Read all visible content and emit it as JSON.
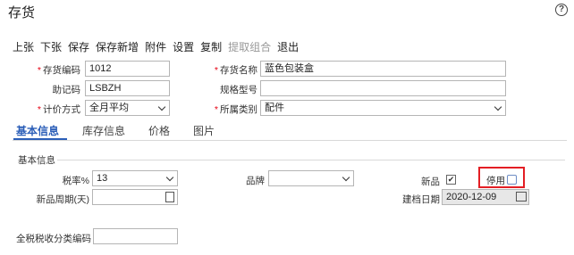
{
  "page": {
    "title": "存货",
    "help_glyph": "?"
  },
  "toolbar": {
    "items": [
      "上张",
      "下张",
      "保存",
      "保存新增",
      "附件",
      "设置",
      "复制",
      "提取组合",
      "退出"
    ]
  },
  "form": {
    "inventory_code": {
      "label": "存货编码",
      "value": "1012"
    },
    "inventory_name": {
      "label": "存货名称",
      "value": "蓝色包装盒"
    },
    "mnemonic": {
      "label": "助记码",
      "value": "LSBZH"
    },
    "spec_model": {
      "label": "规格型号",
      "value": ""
    },
    "pricing_method": {
      "label": "计价方式",
      "value": "全月平均"
    },
    "category": {
      "label": "所属类别",
      "value": "配件"
    }
  },
  "tabs": [
    "基本信息",
    "库存信息",
    "价格",
    "图片"
  ],
  "basic": {
    "section_title": "基本信息",
    "tax_rate": {
      "label": "税率%",
      "value": "13"
    },
    "brand": {
      "label": "品牌",
      "value": ""
    },
    "new_product": {
      "label": "新品",
      "checked": true
    },
    "disabled": {
      "label": "停用",
      "checked": false
    },
    "new_product_period": {
      "label": "新品周期(天)",
      "value": ""
    },
    "created_date": {
      "label": "建档日期",
      "value": "2020-12-09"
    },
    "tax_code": {
      "label": "全税税收分类编码",
      "value": ""
    }
  },
  "colors": {
    "accent": "#2b5eb8",
    "required": "#e60012",
    "highlight_border": "#e31e24"
  }
}
